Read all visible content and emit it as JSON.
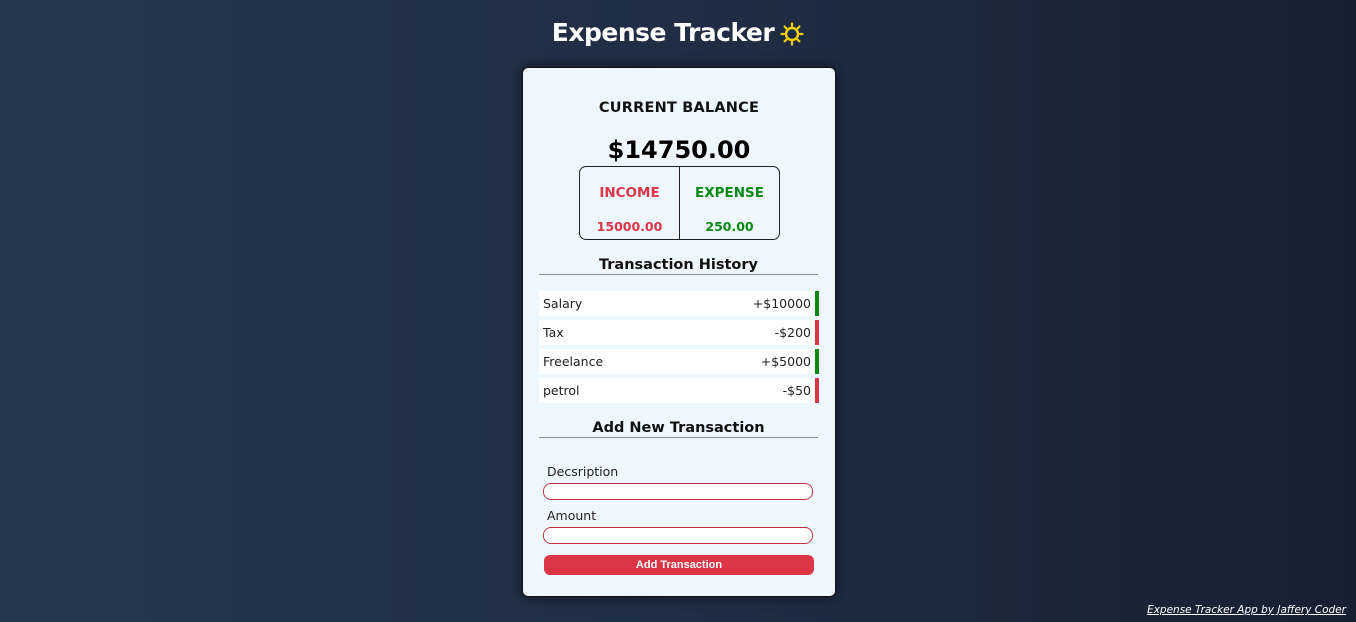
{
  "header": {
    "title": "Expense Tracker",
    "theme_icon": "sun-icon",
    "theme_icon_color": "#f5d000"
  },
  "balance": {
    "label": "CURRENT BALANCE",
    "amount": "$14750.00"
  },
  "summary": {
    "income_label": "INCOME",
    "income_value": "15000.00",
    "expense_label": "EXPENSE",
    "expense_value": "250.00"
  },
  "history": {
    "title": "Transaction History",
    "items": [
      {
        "description": "Salary",
        "amount": "+$10000",
        "type": "income"
      },
      {
        "description": "Tax",
        "amount": "-$200",
        "type": "expense"
      },
      {
        "description": "Freelance",
        "amount": "+$5000",
        "type": "income"
      },
      {
        "description": "petrol",
        "amount": "-$50",
        "type": "expense"
      }
    ]
  },
  "form": {
    "title": "Add New Transaction",
    "description_label": "Decsription",
    "description_value": "",
    "amount_label": "Amount",
    "amount_value": "",
    "submit_label": "Add Transaction"
  },
  "footer": {
    "credit": "Expense Tracker App by Jaffery Coder"
  },
  "colors": {
    "accent_red": "#dc3545",
    "income_green": "#0a8a14",
    "card_background": "#eef6fe"
  }
}
